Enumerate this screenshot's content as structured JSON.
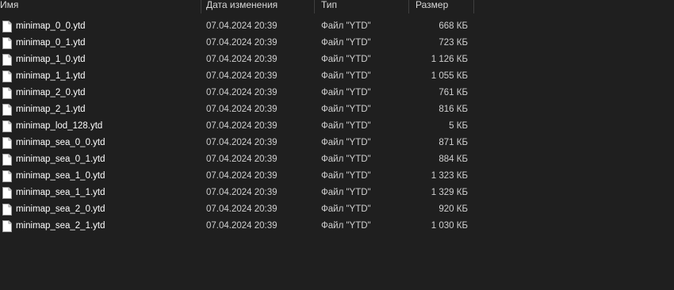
{
  "header": {
    "name": "Имя",
    "date": "Дата изменения",
    "type": "Тип",
    "size": "Размер"
  },
  "icon": "file-icon",
  "files": [
    {
      "name": "minimap_0_0.ytd",
      "date": "07.04.2024 20:39",
      "type": "Файл \"YTD\"",
      "size": "668 КБ"
    },
    {
      "name": "minimap_0_1.ytd",
      "date": "07.04.2024 20:39",
      "type": "Файл \"YTD\"",
      "size": "723 КБ"
    },
    {
      "name": "minimap_1_0.ytd",
      "date": "07.04.2024 20:39",
      "type": "Файл \"YTD\"",
      "size": "1 126 КБ"
    },
    {
      "name": "minimap_1_1.ytd",
      "date": "07.04.2024 20:39",
      "type": "Файл \"YTD\"",
      "size": "1 055 КБ"
    },
    {
      "name": "minimap_2_0.ytd",
      "date": "07.04.2024 20:39",
      "type": "Файл \"YTD\"",
      "size": "761 КБ"
    },
    {
      "name": "minimap_2_1.ytd",
      "date": "07.04.2024 20:39",
      "type": "Файл \"YTD\"",
      "size": "816 КБ"
    },
    {
      "name": "minimap_lod_128.ytd",
      "date": "07.04.2024 20:39",
      "type": "Файл \"YTD\"",
      "size": "5 КБ"
    },
    {
      "name": "minimap_sea_0_0.ytd",
      "date": "07.04.2024 20:39",
      "type": "Файл \"YTD\"",
      "size": "871 КБ"
    },
    {
      "name": "minimap_sea_0_1.ytd",
      "date": "07.04.2024 20:39",
      "type": "Файл \"YTD\"",
      "size": "884 КБ"
    },
    {
      "name": "minimap_sea_1_0.ytd",
      "date": "07.04.2024 20:39",
      "type": "Файл \"YTD\"",
      "size": "1 323 КБ"
    },
    {
      "name": "minimap_sea_1_1.ytd",
      "date": "07.04.2024 20:39",
      "type": "Файл \"YTD\"",
      "size": "1 329 КБ"
    },
    {
      "name": "minimap_sea_2_0.ytd",
      "date": "07.04.2024 20:39",
      "type": "Файл \"YTD\"",
      "size": "920 КБ"
    },
    {
      "name": "minimap_sea_2_1.ytd",
      "date": "07.04.2024 20:39",
      "type": "Файл \"YTD\"",
      "size": "1 030 КБ"
    }
  ]
}
